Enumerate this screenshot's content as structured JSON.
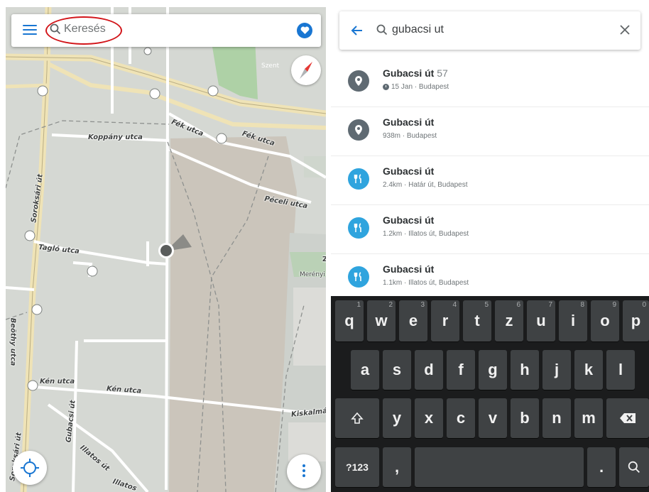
{
  "map_screen": {
    "search_placeholder": "Keresés",
    "icons": {
      "menu": "menu-icon",
      "search": "search-icon",
      "favorites": "heart-icon",
      "compass": "compass-icon",
      "locate": "crosshair-icon",
      "more": "more-vertical-icon"
    },
    "accent_color": "#1976d2",
    "highlight_color": "#d2151a",
    "street_labels": {
      "koppany": "Koppány utca",
      "fek1": "Fék utca",
      "fek2": "Fék utca",
      "peceli": "Péceli utca",
      "taglo": "Tagló utca",
      "soroksari1": "Soroksári út",
      "soroksari2": "Soroksári út",
      "kenutca1": "Kén utca",
      "kenutca2": "Kén utca",
      "gubacsi": "Gubacsi út",
      "illatos1": "Illatos út",
      "illatos2": "Illatos",
      "beothy": "Beöthy utca",
      "kiskalman": "Kiskalmár",
      "merenyi": "Merényi",
      "szent": "Szent",
      "z": "Z"
    }
  },
  "search_screen": {
    "query": "gubacsi ut",
    "icons": {
      "back": "arrow-left-icon",
      "search": "search-icon",
      "clear": "close-icon"
    },
    "results": [
      {
        "title": "Gubacsi út",
        "number": "57",
        "subtitle": "15 Jan · Budapest",
        "icon": "place-pin-icon",
        "has_clock": true
      },
      {
        "title": "Gubacsi út",
        "number": "",
        "subtitle": "938m · Budapest",
        "icon": "place-pin-icon",
        "has_clock": false
      },
      {
        "title": "Gubacsi út",
        "number": "",
        "subtitle": "2.4km · Határ út, Budapest",
        "icon": "restaurant-icon",
        "has_clock": false
      },
      {
        "title": "Gubacsi út",
        "number": "",
        "subtitle": "1.2km · Illatos út, Budapest",
        "icon": "restaurant-icon",
        "has_clock": false
      },
      {
        "title": "Gubacsi út",
        "number": "",
        "subtitle": "1.1km · Illatos út, Budapest",
        "icon": "restaurant-icon",
        "has_clock": false
      }
    ]
  },
  "keyboard": {
    "row1": [
      {
        "key": "q",
        "hint": "1"
      },
      {
        "key": "w",
        "hint": "2"
      },
      {
        "key": "e",
        "hint": "3"
      },
      {
        "key": "r",
        "hint": "4"
      },
      {
        "key": "t",
        "hint": "5"
      },
      {
        "key": "z",
        "hint": "6"
      },
      {
        "key": "u",
        "hint": "7"
      },
      {
        "key": "i",
        "hint": "8"
      },
      {
        "key": "o",
        "hint": "9"
      },
      {
        "key": "p",
        "hint": "0"
      }
    ],
    "row2": [
      "a",
      "s",
      "d",
      "f",
      "g",
      "h",
      "j",
      "k",
      "l"
    ],
    "row3": [
      "y",
      "x",
      "c",
      "v",
      "b",
      "n",
      "m"
    ],
    "shift_icon": "shift-icon",
    "backspace_icon": "backspace-icon",
    "symbols_label": "?123",
    "comma": ",",
    "period": ".",
    "search_key_icon": "search-icon"
  }
}
